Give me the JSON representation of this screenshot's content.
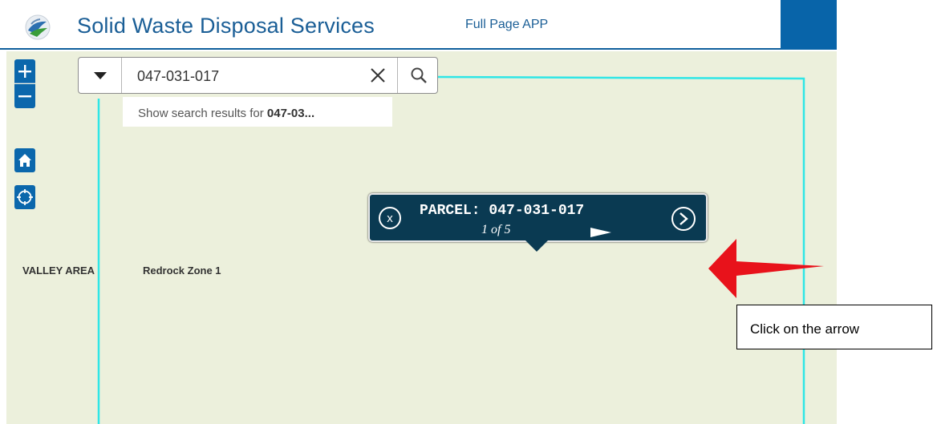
{
  "header": {
    "title": "Solid Waste Disposal Services",
    "full_page_link": "Full Page APP"
  },
  "colors": {
    "brand_blue": "#1a5e96",
    "control_blue": "#0b67ac",
    "map_background": "#ecf0dc",
    "parcel_outline": "#2fe6e6",
    "popup_background": "#0a3a52",
    "annotation_arrow": "#e8121b"
  },
  "map_controls": {
    "zoom_in_icon": "plus-icon",
    "zoom_out_icon": "minus-icon",
    "home_icon": "home-icon",
    "locate_icon": "locate-icon"
  },
  "search": {
    "value": "047-031-017",
    "suggestion_prefix": "Show search results for ",
    "suggestion_term": "047-03..."
  },
  "map_labels": {
    "area": "VALLEY AREA",
    "zone": "Redrock Zone 1"
  },
  "popup": {
    "title": "PARCEL: 047-031-017",
    "count": "1 of 5"
  },
  "annotation": {
    "callout_text": "Click on the arrow"
  }
}
